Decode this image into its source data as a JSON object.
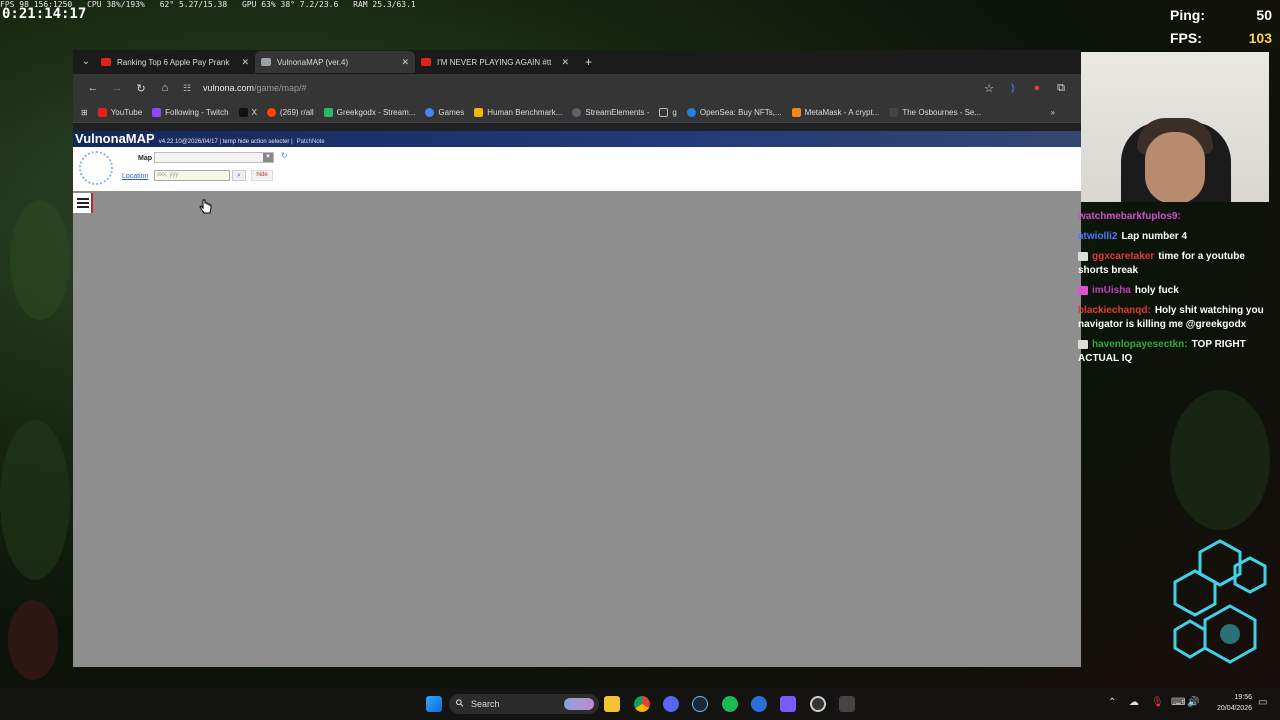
{
  "overlay": {
    "timer": "0:21:14:17",
    "stats": [
      "FPS 98  156:1250",
      "CPU 38%/193%",
      "62°  5.27/15.38",
      "GPU 63%  38°  7.2/23.6",
      "RAM 25.3/63.1"
    ],
    "ping_label": "Ping:",
    "ping_value": "50",
    "fps_label": "FPS:",
    "fps_value": "103"
  },
  "browser": {
    "tabs": [
      {
        "title": "Ranking Top 6 Apple Pay Prank",
        "icon": "youtube-icon",
        "color": "#e62117",
        "active": false
      },
      {
        "title": "VulnonaMAP (ver.4)",
        "icon": "page-icon",
        "color": "#9aa0a6",
        "active": true
      },
      {
        "title": "I'M NEVER PLAYING AGAIN #tt",
        "icon": "youtube-icon",
        "color": "#e62117",
        "active": false
      }
    ],
    "url_host": "vulnona.com",
    "url_path": "/game/map/#",
    "bookmarks": [
      {
        "label": "YouTube",
        "color": "#e62117"
      },
      {
        "label": "Following - Twitch",
        "color": "#9146ff"
      },
      {
        "label": "X",
        "color": "#000000"
      },
      {
        "label": "(269) r/all",
        "color": "#ff4500"
      },
      {
        "label": "Greekgodx - Stream...",
        "color": "#2bb673"
      },
      {
        "label": "Games",
        "color": "#4285f4"
      },
      {
        "label": "Human Benchmark...",
        "color": "#f4b400"
      },
      {
        "label": "StreamElements -",
        "color": "#5f6368"
      },
      {
        "label": "g",
        "color": "#888888"
      },
      {
        "label": "OpenSea: Buy NFTs,...",
        "color": "#2081e2"
      },
      {
        "label": "MetaMask - A crypt...",
        "color": "#f6851b"
      },
      {
        "label": "The Osbournes - Se...",
        "color": "#444444"
      }
    ]
  },
  "page": {
    "title": "VulnonaMAP",
    "version": "v4.22.10@2026/04/17 | temp hide action selecter |",
    "patchnote": "PatchNote",
    "map_label": "Map",
    "location_label": "Location",
    "location_placeholder": "xxx, yyy",
    "hide_label": "hide"
  },
  "chat": [
    {
      "user": "watchmebarkfuplos9:",
      "color": "#d04fd0",
      "text": ""
    },
    {
      "user": "atwiolli2",
      "color": "#4a78ff",
      "text": "Lap number 4"
    },
    {
      "user": "ggxcaretaker",
      "color": "#e23b3b",
      "text": "time for a youtube shorts break"
    },
    {
      "user": "imUisha",
      "color": "#c03cc0",
      "text": "holy fuck"
    },
    {
      "user": "blackiechanqd:",
      "color": "#e23b3b",
      "text": "Holy shit watching you navigator is killing me @greekgodx"
    },
    {
      "user": "havenlopayesectkn:",
      "color": "#2faa3a",
      "text": "TOP RIGHT ACTUAL IQ"
    }
  ],
  "taskbar": {
    "search_label": "Search",
    "time": "19:56",
    "date": "20/04/2026"
  }
}
